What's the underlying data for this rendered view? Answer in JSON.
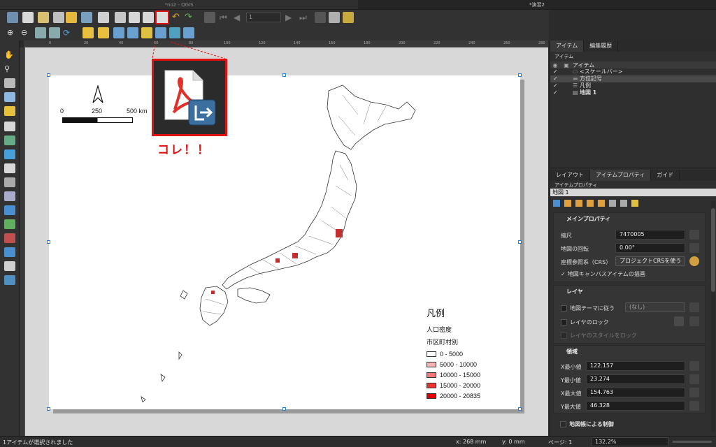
{
  "window": {
    "left_title": "*no2 - QGIS",
    "right_title": "*演習2"
  },
  "toolbar": {
    "page_number": "1"
  },
  "colors": {
    "accent_red": "#e01010",
    "selection_blue": "#2a7fd0"
  },
  "ruler": {
    "h_ticks": [
      "0",
      "20",
      "40",
      "60",
      "80",
      "100",
      "120",
      "140",
      "160",
      "180",
      "200",
      "220",
      "240",
      "260",
      "280"
    ]
  },
  "layout": {
    "scalebar": {
      "labels": [
        "0",
        "250",
        "500 km"
      ]
    },
    "north_arrow_icon": "north-arrow-icon",
    "legend": {
      "title": "凡例",
      "subtitle": "人口密度",
      "layer": "市区町村別",
      "entries": [
        {
          "label": "0 - 5000",
          "color": "#ffffff"
        },
        {
          "label": "5000 - 10000",
          "color": "#f8b4b4"
        },
        {
          "label": "10000 - 15000",
          "color": "#f27777"
        },
        {
          "label": "15000 - 20000",
          "color": "#ee3030"
        },
        {
          "label": "20000 - 20835",
          "color": "#e00000"
        }
      ]
    }
  },
  "callout": {
    "label": "コレ！！",
    "icon": "export-pdf-icon"
  },
  "items_panel": {
    "tabs": [
      "アイテム",
      "編集履歴"
    ],
    "header": "アイテム",
    "column": "アイテム",
    "rows": [
      {
        "label": "<スケールバー>",
        "icon": "scalebar-icon"
      },
      {
        "label": "方位記号",
        "icon": "picture-icon"
      },
      {
        "label": "凡例",
        "icon": "legend-icon"
      },
      {
        "label": "地図 1",
        "icon": "map-icon"
      }
    ]
  },
  "props_panel": {
    "tabs": [
      "レイアウト",
      "アイテムプロパティ",
      "ガイド"
    ],
    "header": "アイテムプロパティ",
    "item_name": "地図 1",
    "main": {
      "title": "メインプロパティ",
      "scale_label": "縮尺",
      "scale_value": "7470005",
      "rotation_label": "地図の回転",
      "rotation_value": "0.00°",
      "crs_label": "座標参照系（CRS）",
      "crs_value": "プロジェクトCRSを使う",
      "draw_items_label": "地図キャンバスアイテムの描画"
    },
    "layers": {
      "title": "レイヤ",
      "theme_label": "地図テーマに従う",
      "theme_value": "(なし)",
      "lock_layers_label": "レイヤのロック",
      "lock_styles_label": "レイヤのスタイルをロック"
    },
    "extent": {
      "title": "領域",
      "xmin_label": "X最小値",
      "xmin": "122.157",
      "ymin_label": "Y最小値",
      "ymin": "23.274",
      "xmax_label": "X最大値",
      "xmax": "154.763",
      "ymax_label": "Y最大値",
      "ymax": "46.328"
    },
    "atlas_label": "地図帳による制御"
  },
  "status": {
    "message": "1アイテムが選択されました",
    "x": "x: 268 mm",
    "y": "y: 0 mm",
    "page": "ページ: 1",
    "zoom": "132.2%"
  }
}
